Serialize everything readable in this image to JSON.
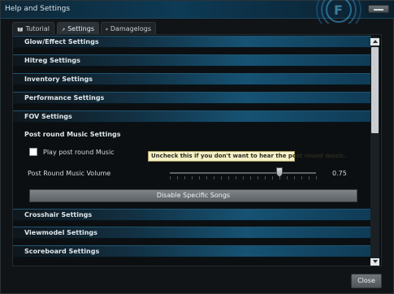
{
  "window": {
    "title": "Help and Settings"
  },
  "tabs": [
    {
      "label": "Tutorial",
      "icon": "book-icon",
      "active": false
    },
    {
      "label": "Settings",
      "icon": "wrench-icon",
      "active": true
    },
    {
      "label": "Damagelogs",
      "icon": "list-icon",
      "active": false
    }
  ],
  "categories": [
    {
      "label": "Glow/Effect Settings"
    },
    {
      "label": "Hitreg Settings"
    },
    {
      "label": "Inventory Settings"
    },
    {
      "label": "Performance Settings"
    },
    {
      "label": "FOV Settings"
    },
    {
      "label": "Post round Music Settings"
    },
    {
      "label": "Crosshair Settings"
    },
    {
      "label": "Viewmodel Settings"
    },
    {
      "label": "Scoreboard Settings"
    }
  ],
  "music": {
    "checkbox_label": "Play post round Music",
    "checked": false,
    "volume_label": "Post Round Music Volume",
    "volume_value": "0.75",
    "volume_fraction": 0.75,
    "disable_button": "Disable Specific Songs"
  },
  "tooltip": "Uncheck this if you don't want to hear the post round music.",
  "footer": {
    "close_label": "Close"
  },
  "colors": {
    "accent": "#165273",
    "tooltip_bg": "#f6f0c6"
  }
}
